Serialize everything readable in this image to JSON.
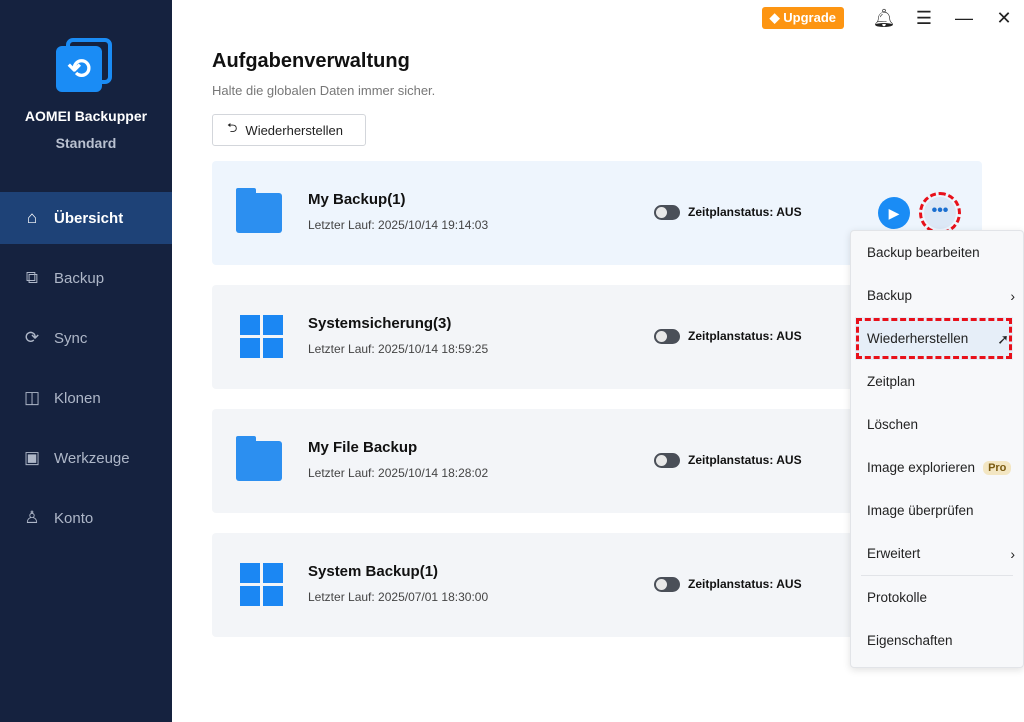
{
  "app": {
    "name": "AOMEI Backupper",
    "edition": "Standard"
  },
  "sidebar": {
    "items": [
      {
        "label": "Übersicht",
        "icon": "⌂"
      },
      {
        "label": "Backup",
        "icon": "⧉"
      },
      {
        "label": "Sync",
        "icon": "⟳"
      },
      {
        "label": "Klonen",
        "icon": "◫"
      },
      {
        "label": "Werkzeuge",
        "icon": "▣"
      },
      {
        "label": "Konto",
        "icon": "♙"
      }
    ]
  },
  "topbar": {
    "upgrade": "Upgrade"
  },
  "main": {
    "title": "Aufgabenverwaltung",
    "subtitle": "Halte die globalen Daten immer sicher.",
    "restore_button": "Wiederherstellen"
  },
  "tasks": [
    {
      "name": "My Backup(1)",
      "last_run": "Letzter Lauf: 2025/10/14 19:14:03",
      "status": "Zeitplanstatus: AUS"
    },
    {
      "name": "Systemsicherung(3)",
      "last_run": "Letzter Lauf: 2025/10/14 18:59:25",
      "status": "Zeitplanstatus: AUS"
    },
    {
      "name": "My File Backup",
      "last_run": "Letzter Lauf: 2025/10/14 18:28:02",
      "status": "Zeitplanstatus: AUS"
    },
    {
      "name": "System Backup(1)",
      "last_run": "Letzter Lauf: 2025/07/01 18:30:00",
      "status": "Zeitplanstatus: AUS"
    }
  ],
  "menu": {
    "items": [
      "Backup bearbeiten",
      "Backup",
      "Wiederherstellen",
      "Zeitplan",
      "Löschen",
      "Image explorieren",
      "Image überprüfen",
      "Erweitert",
      "Protokolle",
      "Eigenschaften"
    ],
    "pro_badge": "Pro"
  }
}
